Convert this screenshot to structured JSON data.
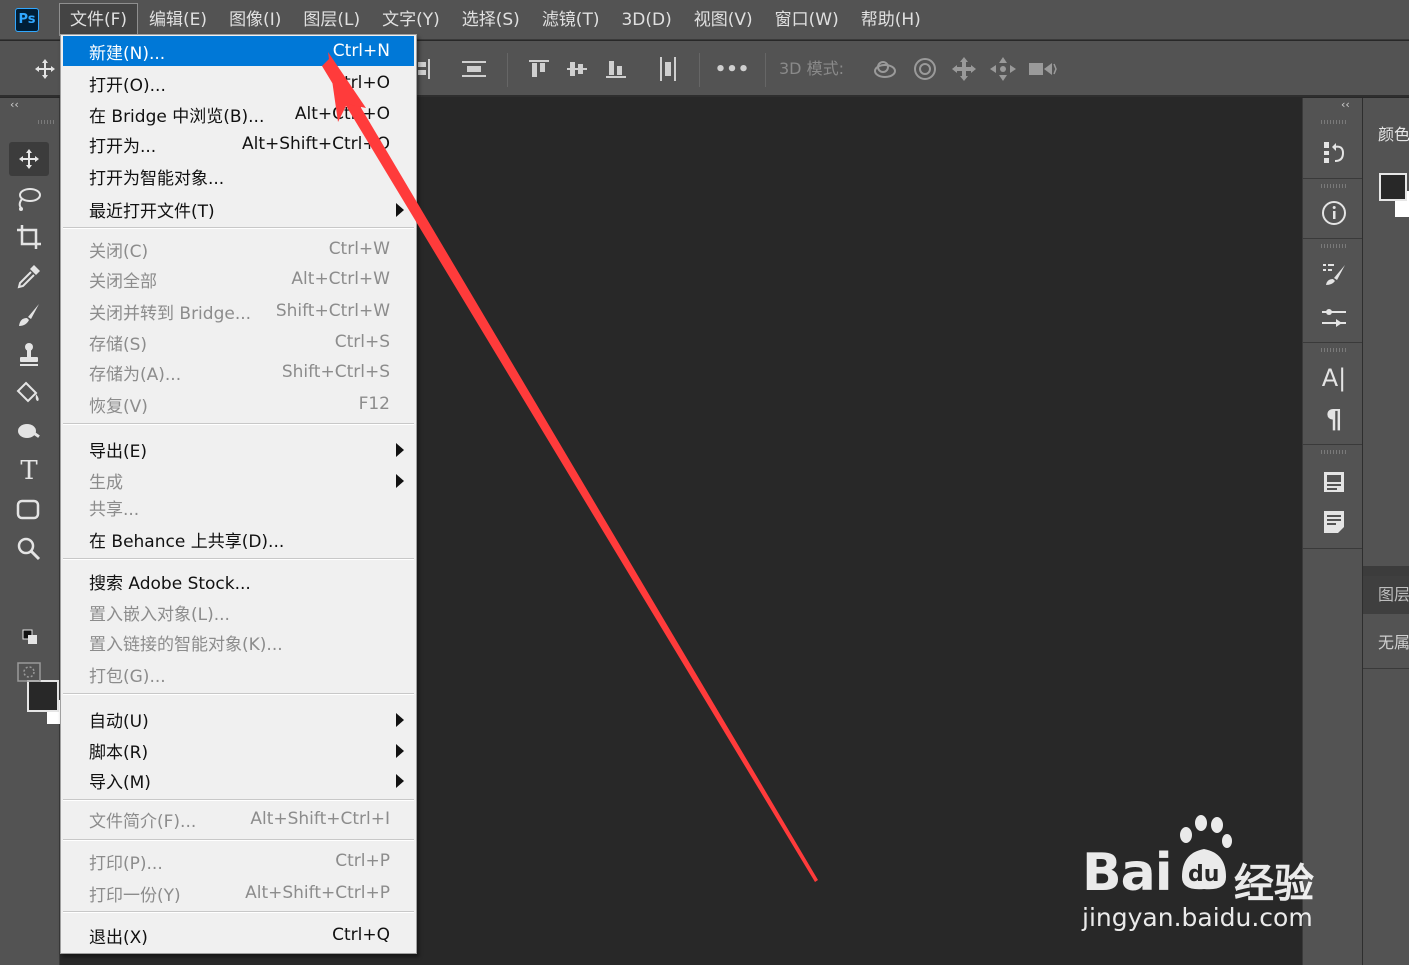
{
  "app": {
    "logo": "Ps"
  },
  "menubar": {
    "items": [
      {
        "label": "文件(F)",
        "active": true
      },
      {
        "label": "编辑(E)"
      },
      {
        "label": "图像(I)"
      },
      {
        "label": "图层(L)"
      },
      {
        "label": "文字(Y)"
      },
      {
        "label": "选择(S)"
      },
      {
        "label": "滤镜(T)"
      },
      {
        "label": "3D(D)"
      },
      {
        "label": "视图(V)"
      },
      {
        "label": "窗口(W)"
      },
      {
        "label": "帮助(H)"
      }
    ]
  },
  "optionsbar": {
    "mode3d_label": "3D 模式:",
    "more_glyph": "•••"
  },
  "left_toolbar": {
    "collapse_glyph": "‹‹"
  },
  "right_panels": {
    "collapse_glyph": "‹‹",
    "color_tab": "颜色",
    "layers_tab": "图层",
    "layers_content": "无属"
  },
  "file_menu": {
    "items": [
      {
        "label": "新建(N)...",
        "shortcut": "Ctrl+N",
        "highlighted": true
      },
      {
        "label": "打开(O)...",
        "shortcut": "Ctrl+O"
      },
      {
        "label": "在 Bridge 中浏览(B)...",
        "shortcut": "Alt+Ctrl+O"
      },
      {
        "label": "打开为...",
        "shortcut": "Alt+Shift+Ctrl+O"
      },
      {
        "label": "打开为智能对象..."
      },
      {
        "label": "最近打开文件(T)",
        "submenu": true
      },
      {
        "label": "关闭(C)",
        "shortcut": "Ctrl+W",
        "disabled": true
      },
      {
        "label": "关闭全部",
        "shortcut": "Alt+Ctrl+W",
        "disabled": true
      },
      {
        "label": "关闭并转到 Bridge...",
        "shortcut": "Shift+Ctrl+W",
        "disabled": true
      },
      {
        "label": "存储(S)",
        "shortcut": "Ctrl+S",
        "disabled": true
      },
      {
        "label": "存储为(A)...",
        "shortcut": "Shift+Ctrl+S",
        "disabled": true
      },
      {
        "label": "恢复(V)",
        "shortcut": "F12",
        "disabled": true
      },
      {
        "label": "导出(E)",
        "submenu": true
      },
      {
        "label": "生成",
        "submenu": true,
        "disabled": true
      },
      {
        "label": "共享...",
        "disabled": true
      },
      {
        "label": "在 Behance 上共享(D)..."
      },
      {
        "label": "搜索 Adobe Stock..."
      },
      {
        "label": "置入嵌入对象(L)...",
        "disabled": true
      },
      {
        "label": "置入链接的智能对象(K)...",
        "disabled": true
      },
      {
        "label": "打包(G)...",
        "disabled": true
      },
      {
        "label": "自动(U)",
        "submenu": true
      },
      {
        "label": "脚本(R)",
        "submenu": true
      },
      {
        "label": "导入(M)",
        "submenu": true
      },
      {
        "label": "文件简介(F)...",
        "shortcut": "Alt+Shift+Ctrl+I",
        "disabled": true
      },
      {
        "label": "打印(P)...",
        "shortcut": "Ctrl+P",
        "disabled": true
      },
      {
        "label": "打印一份(Y)",
        "shortcut": "Alt+Shift+Ctrl+P",
        "disabled": true
      },
      {
        "label": "退出(X)",
        "shortcut": "Ctrl+Q"
      }
    ]
  },
  "watermark": {
    "brand": "Bai",
    "brand_cn": "经验",
    "url": "jingyan.baidu.com"
  },
  "colors": {
    "highlight": "#0078d7",
    "annotation_arrow": "#ff3b3b",
    "panel_bg": "#535353",
    "canvas_bg": "#282828"
  }
}
